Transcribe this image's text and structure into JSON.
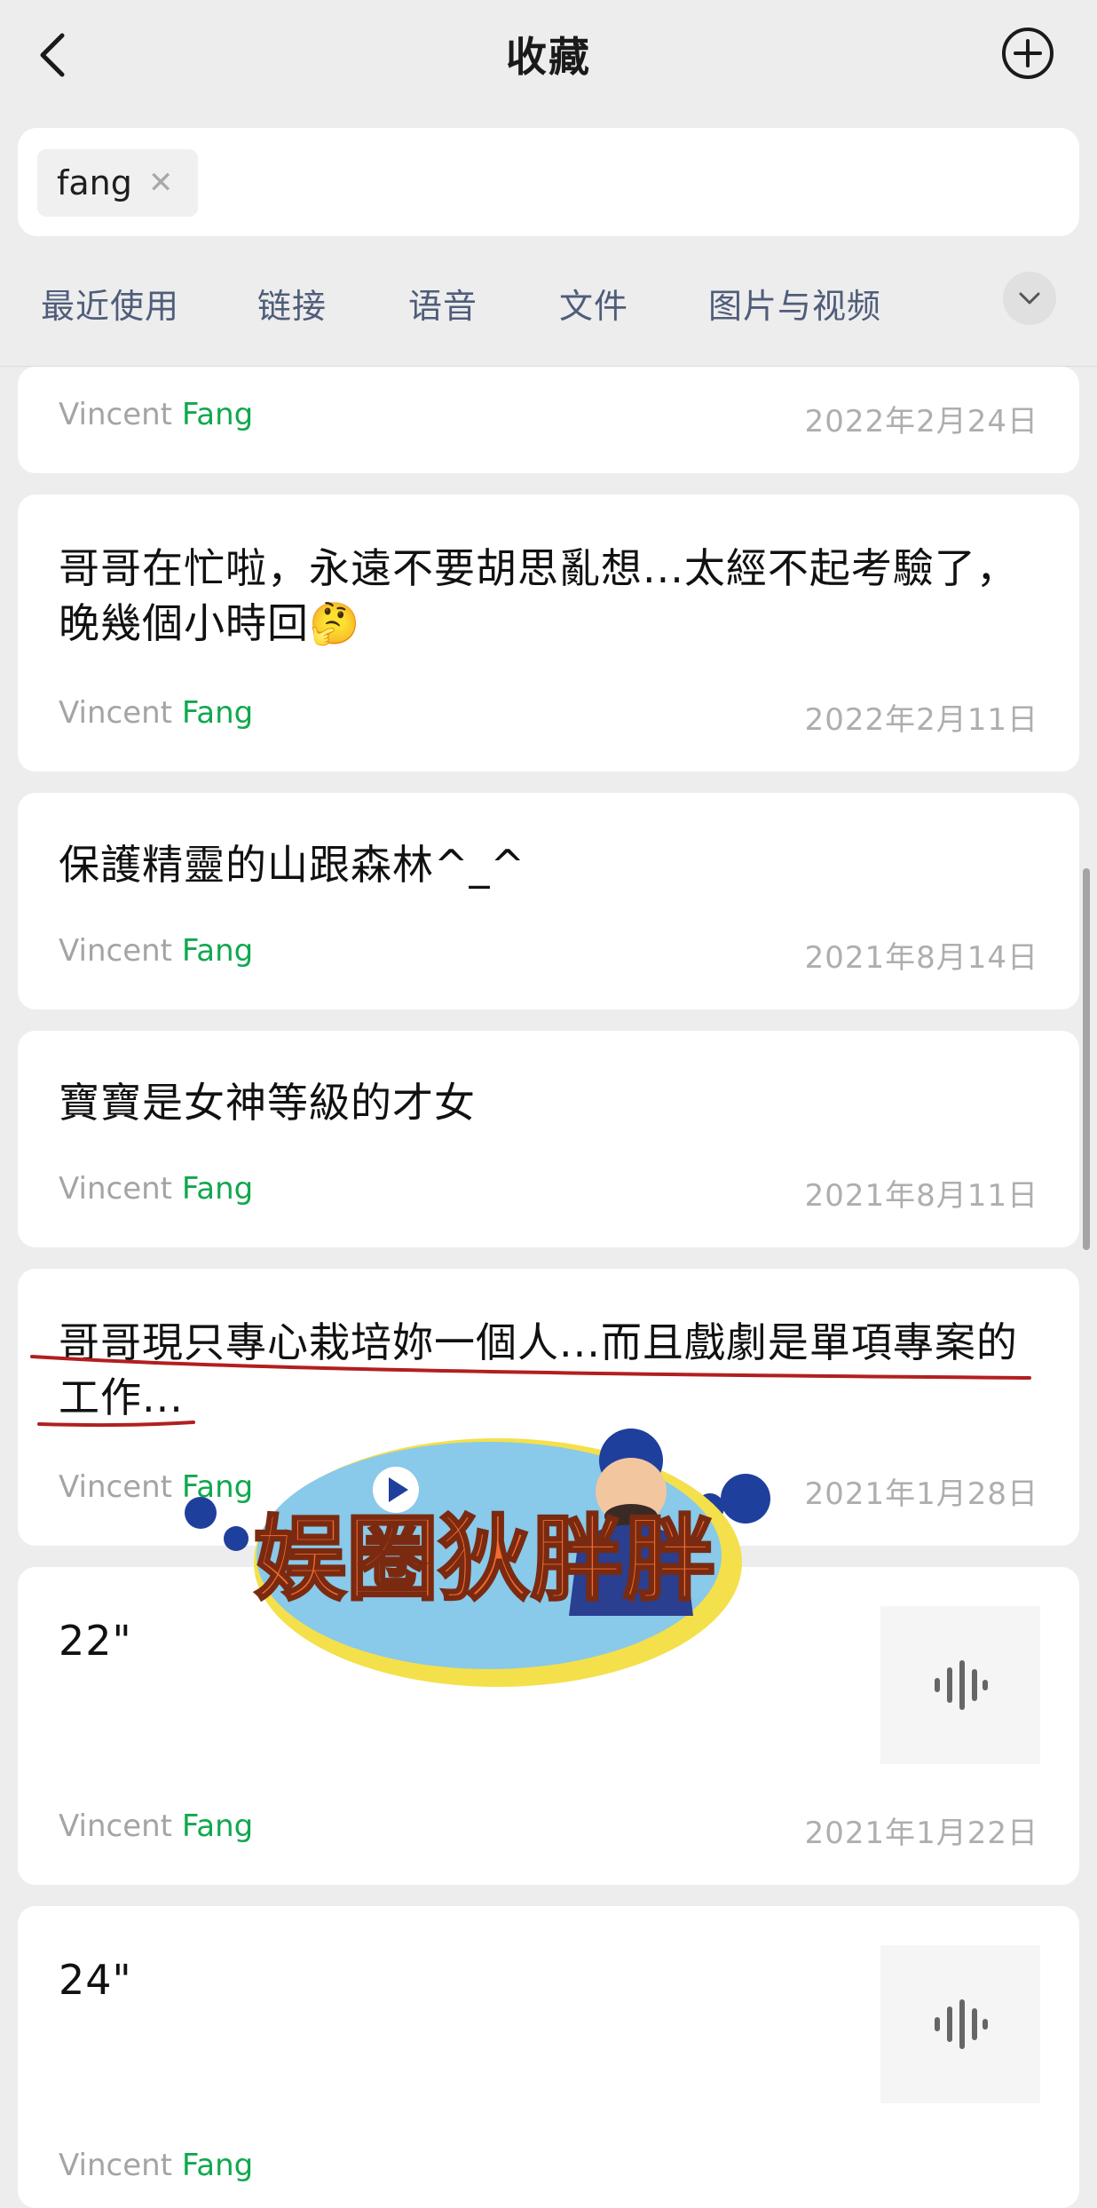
{
  "header": {
    "title": "收藏"
  },
  "search": {
    "chip_label": "fang"
  },
  "filters": [
    "最近使用",
    "链接",
    "语音",
    "文件",
    "图片与视频"
  ],
  "author": {
    "first": "Vincent",
    "last": "Fang"
  },
  "cards": [
    {
      "date": "2022年2月24日"
    },
    {
      "text": "哥哥在忙啦，永遠不要胡思亂想...太經不起考驗了，晚幾個小時回🤔",
      "date": "2022年2月11日"
    },
    {
      "text": "保護精靈的山跟森林^_^",
      "date": "2021年8月14日"
    },
    {
      "text": "寶寶是女神等級的才女",
      "date": "2021年8月11日"
    },
    {
      "text": "哥哥現只專心栽培妳一個人...而且戲劇是單項專案的工作...",
      "date": "2021年1月28日"
    },
    {
      "text": "22\"",
      "date": "2021年1月22日"
    },
    {
      "text": "24\""
    }
  ],
  "sticker": {
    "text": "娱圈狄胖胖"
  },
  "colors": {
    "accent_green": "#10a84e",
    "filter_text": "#4f5d7a",
    "annotation_red": "#b21f1f",
    "sticker_orange": "#f26b2f",
    "sticker_blue": "#1f3f9c"
  },
  "icons": {
    "back": "chevron-left-icon",
    "add": "plus-circle-icon",
    "clear": "close-icon",
    "expand": "chevron-down-icon",
    "voice": "voice-waveform-icon"
  }
}
